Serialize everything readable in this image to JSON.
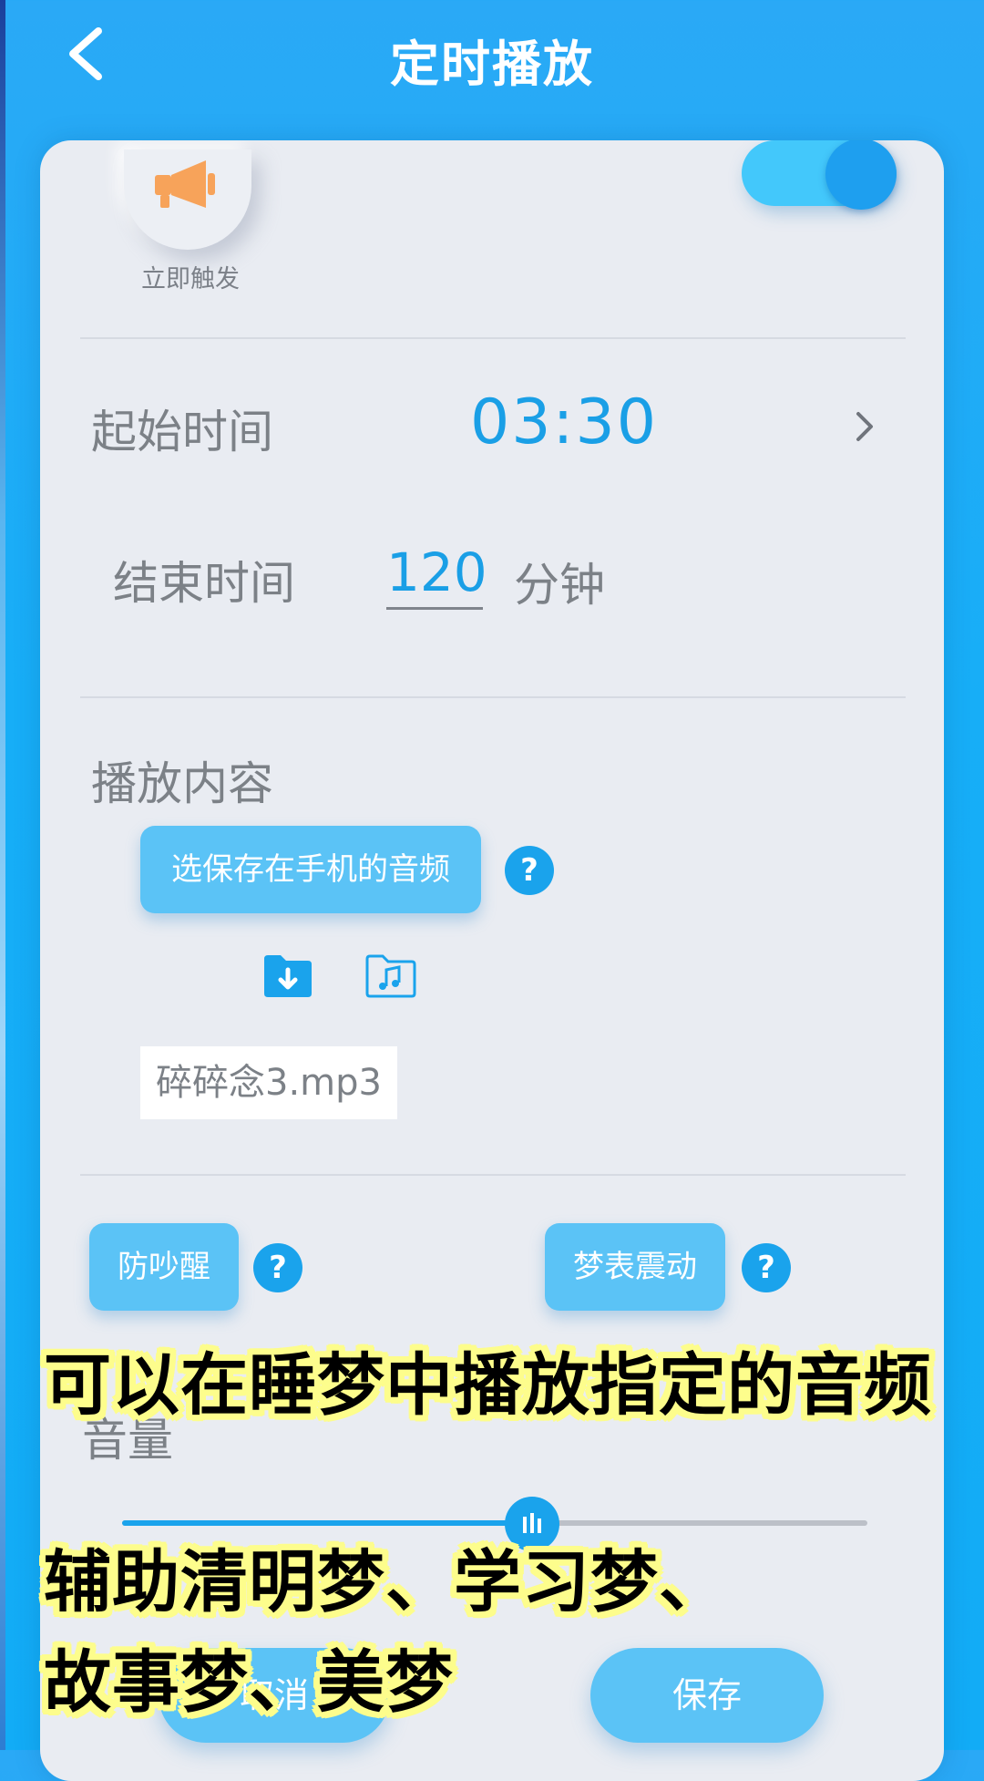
{
  "header": {
    "title": "定时播放"
  },
  "trigger": {
    "label": "立即触发",
    "icon": "megaphone-icon"
  },
  "toggle": {
    "state": "on"
  },
  "start_time": {
    "label": "起始时间",
    "value": "03:30"
  },
  "end_time": {
    "label": "结束时间",
    "value": "120",
    "unit": "分钟"
  },
  "play_content": {
    "label": "播放内容",
    "select_button": "选保存在手机的音频",
    "help": "?",
    "file_name": "碎碎念3.mp3"
  },
  "options": {
    "anti_wake": "防吵醒",
    "dream_vibrate": "梦表震动",
    "help": "?"
  },
  "volume": {
    "label": "音量",
    "level": 0.55
  },
  "buttons": {
    "cancel": "取消",
    "save": "保存"
  },
  "captions": {
    "line1": "可以在睡梦中播放指定的音频",
    "line2": "辅助清明梦、学习梦、",
    "line3": "故事梦、美梦"
  },
  "colors": {
    "accent": "#1aa3ec",
    "pill": "#5bc3f6",
    "caption_bg": "#fdfd8c"
  }
}
